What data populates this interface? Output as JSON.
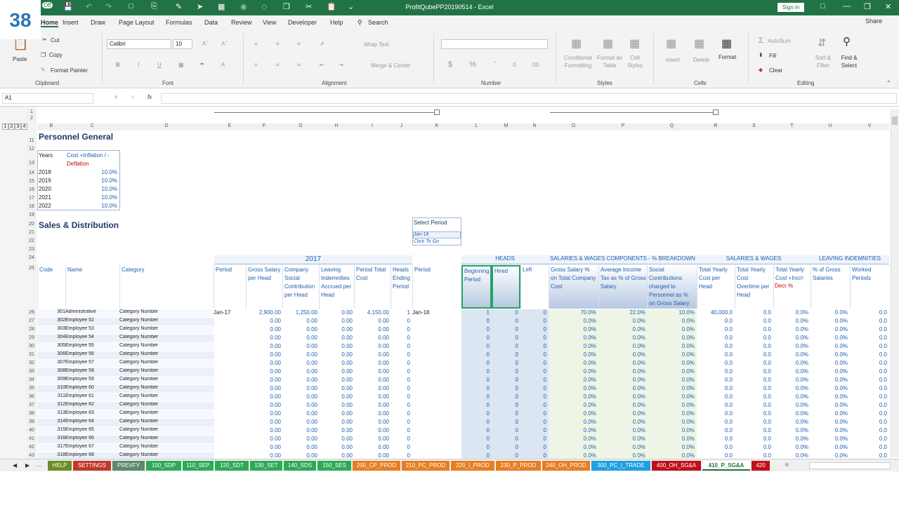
{
  "badge": "38",
  "window": {
    "title": "ProfitQubePP20190514  -  Excel",
    "signin": "Sign in"
  },
  "autosave": "Off",
  "tabs": [
    "Home",
    "Insert",
    "Draw",
    "Page Layout",
    "Formulas",
    "Data",
    "Review",
    "View",
    "Developer",
    "Help"
  ],
  "search": "Search",
  "share": "Share",
  "ribbon": {
    "clipboard": {
      "paste": "Paste",
      "cut": "Cut",
      "copy": "Copy",
      "format_painter": "Format Painter",
      "label": "Clipboard"
    },
    "font": {
      "name": "Calibri",
      "size": "10",
      "label": "Font"
    },
    "alignment": {
      "wrap": "Wrap Text",
      "merge": "Merge & Center",
      "label": "Alignment"
    },
    "number": {
      "label": "Number"
    },
    "styles": {
      "conditional": "Conditional Formatting",
      "format_table": "Format as Table",
      "cell_styles": "Cell Styles",
      "label": "Styles"
    },
    "cells": {
      "insert": "Insert",
      "delete": "Delete",
      "format": "Format",
      "label": "Cells"
    },
    "editing": {
      "autosum": "AutoSum",
      "fill": "Fill",
      "clear": "Clear",
      "sort": "Sort & Filter",
      "find": "Find & Select",
      "label": "Editing"
    }
  },
  "namebox": "A1",
  "fx": "fx",
  "columns": [
    "B",
    "C",
    "D",
    "E",
    "F",
    "G",
    "H",
    "I",
    "J",
    "K",
    "L",
    "M",
    "N",
    "O",
    "P",
    "Q",
    "R",
    "S",
    "T",
    "U",
    "V"
  ],
  "outline_levels": [
    "1",
    "2",
    "3",
    "4"
  ],
  "personnel": {
    "title": "Personnel General",
    "h_years": "Years",
    "h_cost": "Cost +Inflation / -",
    "h_deflation": "Deflation",
    "rows": [
      [
        "2018",
        "10.0%"
      ],
      [
        "2019",
        "10.0%"
      ],
      [
        "2020",
        "10.0%"
      ],
      [
        "2021",
        "10.0%"
      ],
      [
        "2022",
        "10.0%"
      ]
    ]
  },
  "sales_title": "Sales & Distribution",
  "select_period": {
    "label": "Select Period",
    "value": "Jan-18",
    "link": "Click To Go"
  },
  "bands": {
    "year": "2017",
    "heads": "HEADS",
    "components": "SALARIES & WAGES COMPONENTS - % BREAKDOWN",
    "salaries": "SALARIES & WAGES",
    "leaving": "LEAVING INDEMNITIES"
  },
  "headers": [
    "Code",
    "Name",
    "Category",
    "Period",
    "Gross Salary per Head",
    "Company Social Contribution per Head",
    "Leaving Indemnities Accrued per Head",
    "Period Total Cost",
    "Heads Ending Period",
    "Period",
    "Beginning Period",
    "Hired",
    "Left",
    "Gross Salary % on Total Company Cost",
    "Average Income Tax as % of Gross Salary",
    "Social Contributions charged to Personnel as % on Gross Salary",
    "Total Yearly Cost per Head",
    "Total Yearly Cost Overtime per Head",
    "Total Yearly Cost +Incr/-",
    "% of Gross Salaries",
    "Worked Periods"
  ],
  "decr": "Decr %",
  "first_row": {
    "code": "301",
    "name": "Administrative",
    "category": "Category Number",
    "period": "Jan-17",
    "gross": "2,900.00",
    "social": "1,250.00",
    "leaving": "0.00",
    "total": "4,150.00",
    "heads": "1",
    "period2": "Jan-18",
    "begin": "1",
    "hired": "0",
    "left": "0",
    "gross_pct": "70.0%",
    "tax": "22.0%",
    "contrib": "10.0%",
    "yearly": "40,000.0",
    "overtime": "0.0",
    "incr": "0.0%",
    "pct_gross": "0.0%",
    "worked": "0.0"
  },
  "employees": [
    [
      "302",
      "Employee 52"
    ],
    [
      "303",
      "Employee 53"
    ],
    [
      "304",
      "Employee 54"
    ],
    [
      "305",
      "Employee 55"
    ],
    [
      "306",
      "Employee 56"
    ],
    [
      "307",
      "Employee 57"
    ],
    [
      "308",
      "Employee 58"
    ],
    [
      "309",
      "Employee 59"
    ],
    [
      "310",
      "Employee 60"
    ],
    [
      "311",
      "Employee 61"
    ],
    [
      "312",
      "Employee 62"
    ],
    [
      "313",
      "Employee 63"
    ],
    [
      "314",
      "Employee 64"
    ],
    [
      "315",
      "Employee 65"
    ],
    [
      "316",
      "Employee 66"
    ],
    [
      "317",
      "Employee 67"
    ],
    [
      "318",
      "Employee 68"
    ]
  ],
  "zero_row": {
    "category": "Category Number",
    "gross": "0.00",
    "social": "0.00",
    "leaving": "0.00",
    "total": "0.00",
    "heads": "0",
    "begin": "0",
    "hired": "0",
    "left": "0",
    "pct": "0.0%",
    "tax": "0.0%",
    "contrib": "0.0%",
    "yearly": "0.0",
    "overtime": "0.0",
    "incr": "0.0%",
    "pct_gross": "0.0%",
    "worked": "0.0"
  },
  "rownums_top": [
    "1",
    "2"
  ],
  "rownums": [
    "11",
    "12",
    "13",
    "14",
    "15",
    "16",
    "17",
    "18",
    "19",
    "20",
    "21",
    "22",
    "23",
    "24",
    "25",
    "26",
    "27",
    "28",
    "29",
    "30",
    "31",
    "32",
    "33",
    "34",
    "35",
    "36",
    "37",
    "38",
    "39",
    "40",
    "41",
    "42",
    "43"
  ],
  "sheets": [
    {
      "name": "HELP",
      "color": "#6b8e23"
    },
    {
      "name": "SETTINGS",
      "color": "#c0392b"
    },
    {
      "name": "PREVFY",
      "color": "#5a8a6a"
    },
    {
      "name": "100_SDP",
      "color": "#2eaa55"
    },
    {
      "name": "110_SEP",
      "color": "#2eaa55"
    },
    {
      "name": "120_SDT",
      "color": "#2eaa55"
    },
    {
      "name": "130_SET",
      "color": "#2eaa55"
    },
    {
      "name": "140_SDS",
      "color": "#2eaa55"
    },
    {
      "name": "150_SES",
      "color": "#2eaa55"
    },
    {
      "name": "200_CP_PROD",
      "color": "#e67e22"
    },
    {
      "name": "210_PC_PROD",
      "color": "#e67e22"
    },
    {
      "name": "220_I_PROD",
      "color": "#e67e22"
    },
    {
      "name": "230_P_PROD",
      "color": "#e67e22"
    },
    {
      "name": "240_OH_PROD",
      "color": "#e67e22"
    },
    {
      "name": "300_PC_I_TRADE",
      "color": "#1fa0e0"
    },
    {
      "name": "400_OH_SG&A",
      "color": "#c0101a"
    },
    {
      "name": "410_P_SG&A",
      "color": "#ffffff"
    },
    {
      "name": "420",
      "color": "#c0101a"
    }
  ],
  "accent": "#217346"
}
